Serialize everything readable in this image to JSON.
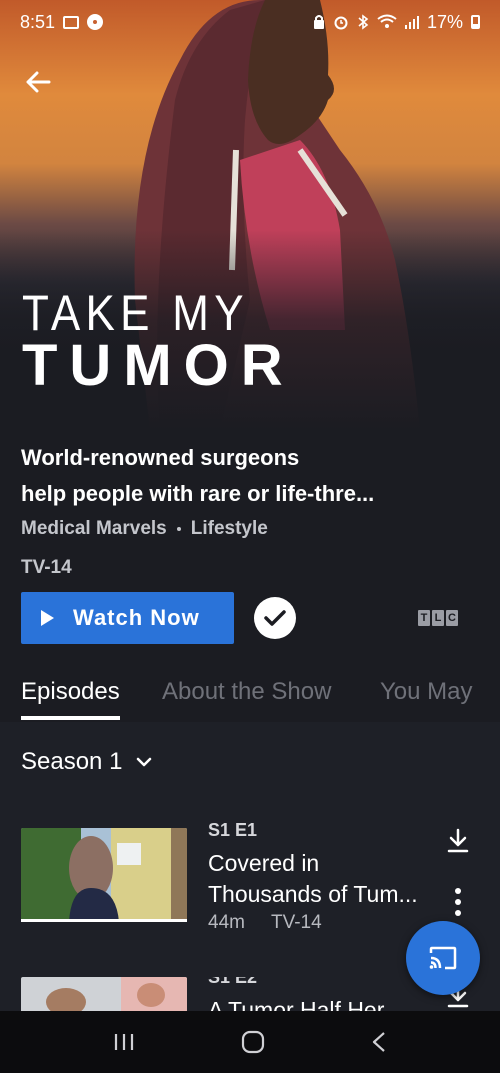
{
  "status_bar": {
    "time": "8:51",
    "battery": "17%"
  },
  "show": {
    "logo_line1": "TAKE MY",
    "logo_line2": "TUMOR",
    "description_line1": "World-renowned surgeons",
    "description_line2": "help people with rare or life-thre...",
    "genres": [
      "Medical Marvels",
      "Lifestyle"
    ],
    "rating": "TV-14",
    "network_letters": [
      "T",
      "L",
      "C"
    ]
  },
  "actions": {
    "watch_label": "Watch Now"
  },
  "tabs": [
    {
      "label": "Episodes",
      "active": true
    },
    {
      "label": "About the Show",
      "active": false
    },
    {
      "label": "You May",
      "active": false
    }
  ],
  "season": {
    "label": "Season 1"
  },
  "episodes": [
    {
      "number": "S1 E1",
      "title": "Covered in Thousands of Tum...",
      "duration": "44m",
      "rating": "TV-14"
    },
    {
      "number": "S1 E2",
      "title": "A Tumor Half Her"
    }
  ],
  "colors": {
    "accent": "#2a73d9",
    "background": "#1b1c22"
  },
  "icons": [
    "back-arrow-icon",
    "play-icon",
    "check-icon",
    "chevron-down-icon",
    "download-icon",
    "more-vertical-icon",
    "cast-icon",
    "recents-icon",
    "home-icon",
    "nav-back-icon"
  ]
}
